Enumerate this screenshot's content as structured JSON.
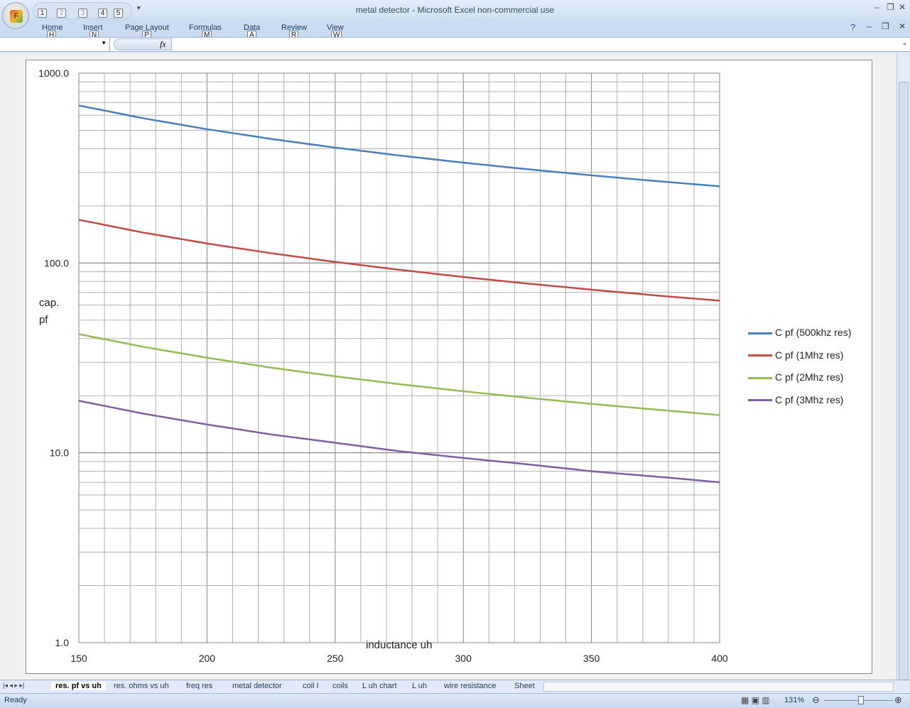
{
  "window": {
    "title": "metal detector - Microsoft Excel non-commercial use",
    "office_key": "F"
  },
  "qat_keys": [
    "1",
    "2",
    "3",
    "4",
    "5"
  ],
  "ribbon_tabs": [
    {
      "label": "Home",
      "key": "H"
    },
    {
      "label": "Insert",
      "key": "N"
    },
    {
      "label": "Page Layout",
      "key": "P"
    },
    {
      "label": "Formulas",
      "key": "M"
    },
    {
      "label": "Data",
      "key": "A"
    },
    {
      "label": "Review",
      "key": "R"
    },
    {
      "label": "View",
      "key": "W"
    }
  ],
  "formula_bar": {
    "name_box": "",
    "fx": "fx",
    "formula": ""
  },
  "sheet_tabs": [
    "res. pf vs uh",
    "res. ohms vs uh",
    "freq  res",
    "metal detector",
    "coil I",
    "coils",
    "L uh chart",
    "L uh",
    "wire resistance",
    "Sheet"
  ],
  "active_sheet": 0,
  "status": {
    "ready": "Ready",
    "zoom": "131%"
  },
  "colors": {
    "s1": "#4a7ebb",
    "s2": "#be4b48",
    "s3": "#98b954",
    "s4": "#7d60a0"
  },
  "chart_data": {
    "type": "line",
    "xlabel": "inductance uh",
    "ylabel": "cap.\npf",
    "ylabel_lines": [
      "cap.",
      "pf"
    ],
    "yscale": "log",
    "ylim": [
      1,
      1000
    ],
    "xlim": [
      150,
      400
    ],
    "xticks": [
      "150",
      "200",
      "250",
      "300",
      "350",
      "400"
    ],
    "yticks": [
      "1.0",
      "10.0",
      "100.0",
      "1000.0"
    ],
    "grid": true,
    "legend_position": "right",
    "x": [
      150,
      175,
      200,
      225,
      250,
      275,
      300,
      325,
      350,
      375,
      400
    ],
    "series": [
      {
        "name": "C pf (500khz res)",
        "values": [
          675.5,
          579.0,
          506.6,
          450.3,
          405.3,
          368.4,
          337.7,
          311.8,
          289.5,
          270.2,
          253.3
        ]
      },
      {
        "name": "C pf (1Mhz res)",
        "values": [
          168.9,
          144.7,
          126.7,
          112.6,
          101.3,
          92.1,
          84.4,
          77.9,
          72.4,
          67.5,
          63.3
        ]
      },
      {
        "name": "C pf (2Mhz res)",
        "values": [
          42.2,
          36.2,
          31.7,
          28.1,
          25.3,
          23.0,
          21.1,
          19.5,
          18.1,
          16.9,
          15.8
        ]
      },
      {
        "name": "C pf (3Mhz res)",
        "values": [
          18.8,
          16.1,
          14.1,
          12.5,
          11.3,
          10.2,
          9.4,
          8.7,
          8.0,
          7.5,
          7.0
        ]
      }
    ]
  }
}
